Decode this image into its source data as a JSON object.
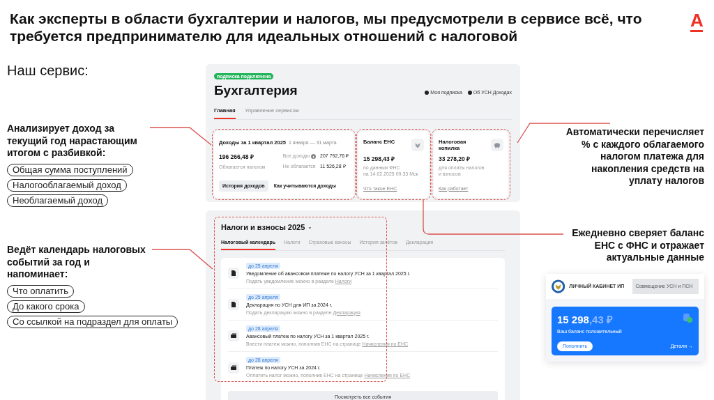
{
  "slide": {
    "title": "Как эксперты в области бухгалтерии и налогов, мы предусмотрели в сервисе всё, что требуется предпринимателю для идеальных отношений с налоговой",
    "logo": "А",
    "subtitle": "Наш сервис:"
  },
  "left_callouts": [
    {
      "text": "Анализирует доход за текущий год нарастающим итогом с разбивкой:",
      "tags": [
        "Общая сумма поступлений",
        "Налогооблагаемый доход",
        "Необлагаемый доход"
      ]
    },
    {
      "text": "Ведёт календарь налоговых событий за год и напоминает:",
      "tags": [
        "Что оплатить",
        "До какого срока",
        "Со ссылкой на подраздел для оплаты"
      ]
    }
  ],
  "right_callouts": [
    {
      "text": "Автоматически перечисляет % с каждого облагаемого налогом платежа для накопления средств на уплату налогов"
    },
    {
      "text": "Ежедневно сверяет баланс ЕНС с ФНС и отражает актуальные данные"
    }
  ],
  "accounting": {
    "badge": "подписка подключена",
    "title": "Бухгалтерия",
    "links": [
      "Моя подписка",
      "Об УСН Доходах"
    ],
    "tabs": [
      {
        "label": "Главная",
        "selected": true
      },
      {
        "label": "Управление сервисом",
        "selected": false
      }
    ],
    "income": {
      "title": "Доходы за 1 квартал 2025",
      "period": "1 января — 31 марта",
      "amount": "196 266,48 ₽",
      "amount_label": "Облагается налогом",
      "rows": [
        {
          "label": "Все доходы",
          "info": true,
          "value": "207 792,76 ₽"
        },
        {
          "label": "Не облагается",
          "info": false,
          "value": "11 526,28 ₽"
        }
      ],
      "buttons": [
        "История доходов",
        "Как учитываются доходы"
      ]
    },
    "ens": {
      "title": "Баланс ЕНС",
      "amount": "15 298,43 ₽",
      "notes": [
        "по данным ФНС",
        "на 14.02.2025 09:33 Мск"
      ],
      "link": "Что такое ЕНС"
    },
    "piggy": {
      "title": "Налоговая копилка",
      "amount": "33 278,20 ₽",
      "notes": [
        "для оплаты налогов",
        "и взносов"
      ],
      "link": "Как работает"
    }
  },
  "taxes": {
    "title": "Налоги и взносы 2025",
    "chevron": "⌄",
    "tabs": [
      {
        "label": "Налоговый календарь",
        "selected": true
      },
      {
        "label": "Налоги",
        "selected": false
      },
      {
        "label": "Страховые взносы",
        "selected": false
      },
      {
        "label": "История зачётов",
        "selected": false
      },
      {
        "label": "Декларация",
        "selected": false
      }
    ],
    "events": [
      {
        "kind": "document",
        "due": "до 25 апреля",
        "text": "Уведомление об авансовом платеже по налогу УСН за 1 квартал 2025 г.",
        "hint": "Подать уведомление можно в разделе",
        "link": "Налоги"
      },
      {
        "kind": "document",
        "due": "до 25 апреля",
        "text": "Декларация по УСН для ИП за 2024 г.",
        "hint": "Подать декларацию можно в разделе",
        "link": "Декларация"
      },
      {
        "kind": "payment",
        "due": "до 28 апреля",
        "text": "Авансовый платеж по налогу УСН за 1 квартал 2025 г.",
        "hint": "Внести платеж можно, пополнив ЕНС на странице",
        "link": "Начисления по ЕНС"
      },
      {
        "kind": "payment",
        "due": "до 28 апреля",
        "text": "Платеж по налогу УСН за 2024 г.",
        "hint": "Оплатить налог можно, пополнив ЕНС на странице",
        "link": "Начисления по ЕНС"
      }
    ],
    "all_button": "Посмотреть все события"
  },
  "fns": {
    "cabinet": "ЛИЧНЫЙ КАБИНЕТ ИП",
    "tooltip": "Совмещение УСН и ПСН",
    "amount_main": "15 298",
    "amount_cents": ",43 ₽",
    "status": "Ваш баланс положительный",
    "button": "Пополнить",
    "link": "Детали →"
  }
}
